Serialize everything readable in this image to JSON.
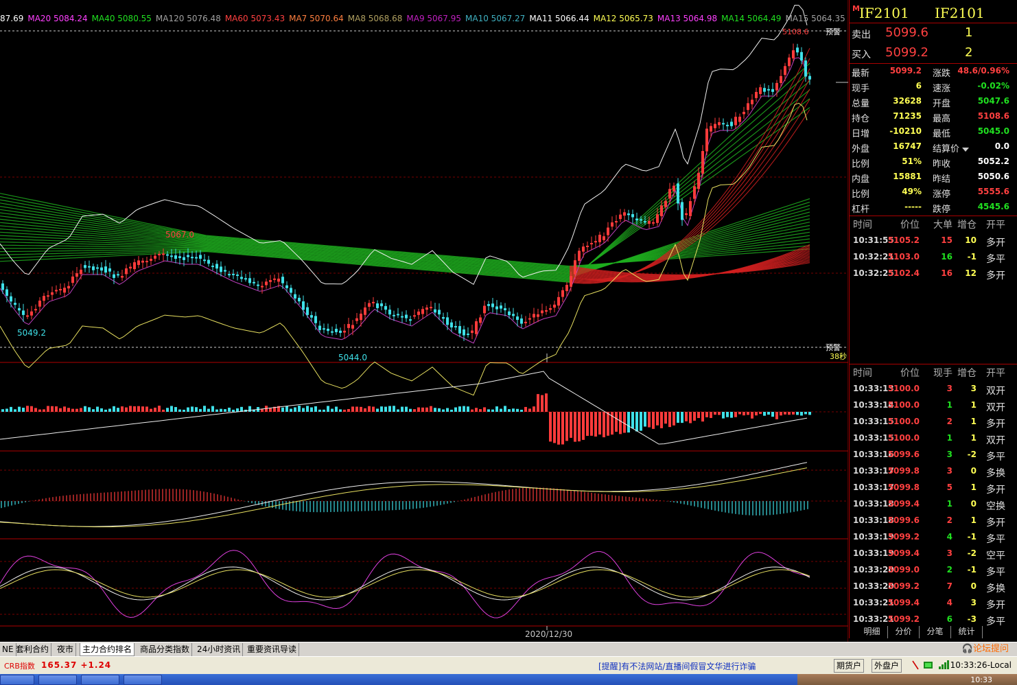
{
  "ma_strip": [
    {
      "label": "87.69",
      "color": "#ffffff"
    },
    {
      "label": "MA20 5084.24",
      "color": "#ff40ff"
    },
    {
      "label": "MA40 5080.55",
      "color": "#20e020"
    },
    {
      "label": "MA120 5076.48",
      "color": "#a0a0a0"
    },
    {
      "label": "MA60 5073.43",
      "color": "#ff4040"
    },
    {
      "label": "MA7 5070.64",
      "color": "#ff7f3f"
    },
    {
      "label": "MA8 5068.68",
      "color": "#b0a060"
    },
    {
      "label": "MA9 5067.95",
      "color": "#c020c0"
    },
    {
      "label": "MA10 5067.27",
      "color": "#3fb0c0"
    },
    {
      "label": "MA11 5066.44",
      "color": "#ffffff"
    },
    {
      "label": "MA12 5065.73",
      "color": "#ffff54"
    },
    {
      "label": "MA13 5064.98",
      "color": "#ff40ff"
    },
    {
      "label": "MA14 5064.49",
      "color": "#20e020"
    },
    {
      "label": "MA15 5064.35",
      "color": "#a0a0a0"
    }
  ],
  "chart": {
    "high_label": "5108.6",
    "high_value": 5108.6,
    "alert_top": "预警",
    "alert_bottom": "预警",
    "countdown": "38秒",
    "low1_label": "5049.2",
    "low1_value": 5049.2,
    "low2_label": "5044.0",
    "low2_value": 5044.0,
    "peak1_label": "5067.0",
    "peak1_value": 5067.0,
    "date_label": "2020/12/30",
    "colors": {
      "up": "#ff3b3b",
      "down": "#3fe0e8",
      "grid": "#7a0000",
      "axis": "#b00000"
    }
  },
  "quote": {
    "symbol_left": "IF2101",
    "symbol_right": "IF2101",
    "badge": "M",
    "ask_label": "卖出",
    "ask_price": "5099.6",
    "ask_qty": "1",
    "bid_label": "买入",
    "bid_price": "5099.2",
    "bid_qty": "2",
    "stats": [
      {
        "l1": "最新",
        "v1": "5099.2",
        "c1": "#ff4040",
        "l2": "涨跌",
        "v2": "48.6/0.96%",
        "c2": "#ff4040"
      },
      {
        "l1": "现手",
        "v1": "6",
        "c1": "#ffff54",
        "l2": "速涨",
        "v2": "-0.02%",
        "c2": "#20e020"
      },
      {
        "l1": "总量",
        "v1": "32628",
        "c1": "#ffff54",
        "l2": "开盘",
        "v2": "5047.6",
        "c2": "#20e020"
      },
      {
        "l1": "持仓",
        "v1": "71235",
        "c1": "#ffff54",
        "l2": "最高",
        "v2": "5108.6",
        "c2": "#ff4040"
      },
      {
        "l1": "日增",
        "v1": "-10210",
        "c1": "#ffff54",
        "l2": "最低",
        "v2": "5045.0",
        "c2": "#20e020"
      },
      {
        "l1": "外盘",
        "v1": "16747",
        "c1": "#ffff54",
        "l2": "结算价",
        "v2": "0.0",
        "c2": "#ffffff"
      },
      {
        "l1": "比例",
        "v1": "51%",
        "c1": "#ffff54",
        "l2": "昨收",
        "v2": "5052.2",
        "c2": "#ffffff"
      },
      {
        "l1": "内盘",
        "v1": "15881",
        "c1": "#ffff54",
        "l2": "昨结",
        "v2": "5050.6",
        "c2": "#ffffff"
      },
      {
        "l1": "比例",
        "v1": "49%",
        "c1": "#ffff54",
        "l2": "涨停",
        "v2": "5555.6",
        "c2": "#ff4040"
      },
      {
        "l1": "杠杆",
        "v1": "-----",
        "c1": "#ffff54",
        "l2": "跌停",
        "v2": "4545.6",
        "c2": "#20e020"
      }
    ],
    "big_orders": {
      "headers": [
        "时间",
        "价位",
        "大单",
        "增仓",
        "开平"
      ],
      "rows": [
        {
          "time": "10:31:55",
          "price": "5105.2",
          "vol": "15",
          "chg": "10",
          "type": "多开",
          "vcolor": "#ff4040",
          "ccolor": "#ffff54"
        },
        {
          "time": "10:32:21",
          "price": "5103.0",
          "vol": "16",
          "chg": "-1",
          "type": "多平",
          "vcolor": "#20e020",
          "ccolor": "#ffff54"
        },
        {
          "time": "10:32:25",
          "price": "5102.4",
          "vol": "16",
          "chg": "12",
          "type": "多开",
          "vcolor": "#ff4040",
          "ccolor": "#ffff54"
        }
      ]
    },
    "ticks": {
      "headers": [
        "时间",
        "价位",
        "现手",
        "增仓",
        "开平"
      ],
      "rows": [
        {
          "time": "10:33:13",
          "price": "5100.0",
          "vol": "3",
          "chg": "3",
          "type": "双开",
          "vcolor": "#ff4040"
        },
        {
          "time": "10:33:14",
          "price": "5100.0",
          "vol": "1",
          "chg": "1",
          "type": "双开",
          "vcolor": "#20e020"
        },
        {
          "time": "10:33:15",
          "price": "5100.0",
          "vol": "2",
          "chg": "1",
          "type": "多开",
          "vcolor": "#ff4040"
        },
        {
          "time": "10:33:15",
          "price": "5100.0",
          "vol": "1",
          "chg": "1",
          "type": "双开",
          "vcolor": "#20e020"
        },
        {
          "time": "10:33:16",
          "price": "5099.6",
          "vol": "3",
          "chg": "-2",
          "type": "多平",
          "vcolor": "#20e020"
        },
        {
          "time": "10:33:17",
          "price": "5099.8",
          "vol": "3",
          "chg": "0",
          "type": "多换",
          "vcolor": "#ff4040"
        },
        {
          "time": "10:33:17",
          "price": "5099.8",
          "vol": "5",
          "chg": "1",
          "type": "多开",
          "vcolor": "#ff4040"
        },
        {
          "time": "10:33:18",
          "price": "5099.4",
          "vol": "1",
          "chg": "0",
          "type": "空换",
          "vcolor": "#20e020"
        },
        {
          "time": "10:33:18",
          "price": "5099.6",
          "vol": "2",
          "chg": "1",
          "type": "多开",
          "vcolor": "#ff4040"
        },
        {
          "time": "10:33:19",
          "price": "5099.2",
          "vol": "4",
          "chg": "-1",
          "type": "多平",
          "vcolor": "#20e020"
        },
        {
          "time": "10:33:19",
          "price": "5099.4",
          "vol": "3",
          "chg": "-2",
          "type": "空平",
          "vcolor": "#ff4040"
        },
        {
          "time": "10:33:20",
          "price": "5099.0",
          "vol": "2",
          "chg": "-1",
          "type": "多平",
          "vcolor": "#20e020"
        },
        {
          "time": "10:33:20",
          "price": "5099.2",
          "vol": "7",
          "chg": "0",
          "type": "多换",
          "vcolor": "#ff4040"
        },
        {
          "time": "10:33:21",
          "price": "5099.4",
          "vol": "4",
          "chg": "3",
          "type": "多开",
          "vcolor": "#ff4040"
        },
        {
          "time": "10:33:21",
          "price": "5099.2",
          "vol": "6",
          "chg": "-3",
          "type": "多平",
          "vcolor": "#20e020"
        }
      ]
    },
    "detail_tabs": [
      "明细",
      "分价",
      "分笔",
      "统计"
    ]
  },
  "bottom_tabs": {
    "items": [
      "NE",
      "套利合约",
      "夜市",
      "主力合约排名",
      "商品分类指数",
      "24小时资讯",
      "重要资讯导读"
    ],
    "active": "主力合约排名",
    "forum": "论坛提问"
  },
  "status": {
    "crb_label": "CRB指数",
    "crb_value": "165.37 +1.24",
    "notice": "[提醒]有不法网站/直播间假冒文华进行诈骗",
    "btn_futures": "期货户",
    "btn_external": "外盘户",
    "clock": "10:33:26-Local"
  },
  "taskbar": {
    "clock": "10:33"
  }
}
